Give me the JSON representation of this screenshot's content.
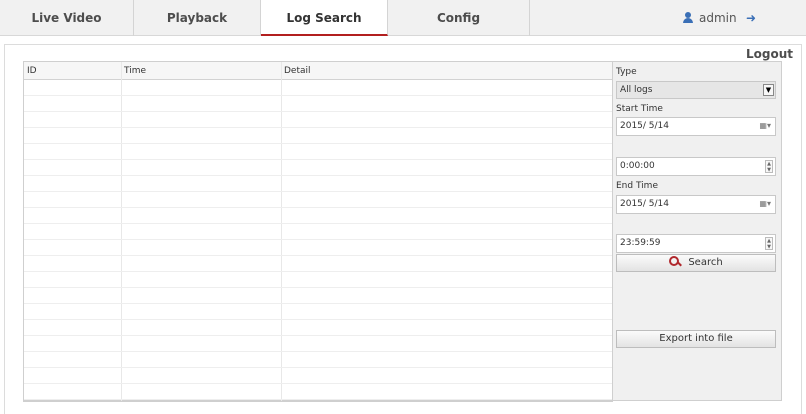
{
  "nav": {
    "tabs": [
      {
        "label": "Live Video",
        "active": false
      },
      {
        "label": "Playback",
        "active": false
      },
      {
        "label": "Log Search",
        "active": true
      },
      {
        "label": "Config",
        "active": false
      }
    ],
    "user": "admin",
    "logout": "Logout"
  },
  "table": {
    "columns": [
      "ID",
      "Time",
      "Detail"
    ],
    "rows": []
  },
  "search_panel": {
    "type_label": "Type",
    "type_value": "All logs",
    "start_label": "Start Time",
    "start_date": "2015/ 5/14",
    "start_time": "0:00:00",
    "end_label": "End Time",
    "end_date": "2015/ 5/14",
    "end_time": "23:59:59",
    "search_button": "Search",
    "export_button": "Export into file"
  },
  "colors": {
    "accent": "#b21f1f",
    "icon_blue": "#3a6fb6"
  },
  "icons": [
    "user-icon",
    "logout-icon",
    "calendar-icon",
    "dropdown-arrow-icon",
    "spinner-icon",
    "search-icon"
  ]
}
